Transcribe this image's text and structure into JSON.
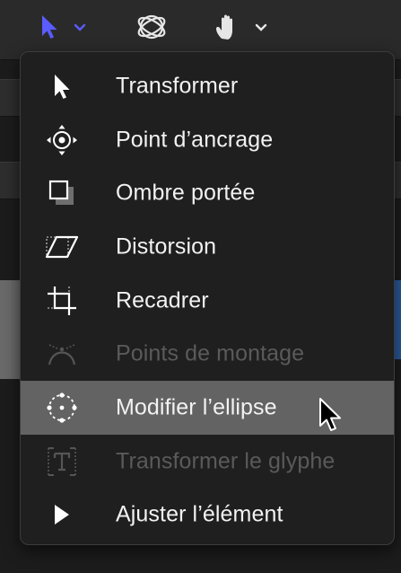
{
  "toolbar": {
    "select_tool_icon": "arrow-pointer-icon",
    "select_tool_dropdown_icon": "chevron-down-icon",
    "orbit_tool_icon": "3d-orbit-icon",
    "pan_tool_icon": "hand-icon",
    "pan_tool_dropdown_icon": "chevron-down-icon",
    "accent_color": "#5a5cff"
  },
  "menu": {
    "highlight_color": "#636363",
    "items": [
      {
        "label": "Transformer",
        "icon": "arrow-pointer-icon",
        "enabled": true,
        "selected": false
      },
      {
        "label": "Point d’ancrage",
        "icon": "anchor-point-icon",
        "enabled": true,
        "selected": false
      },
      {
        "label": "Ombre portée",
        "icon": "drop-shadow-icon",
        "enabled": true,
        "selected": false
      },
      {
        "label": "Distorsion",
        "icon": "distort-icon",
        "enabled": true,
        "selected": false
      },
      {
        "label": "Recadrer",
        "icon": "crop-icon",
        "enabled": true,
        "selected": false
      },
      {
        "label": "Points de montage",
        "icon": "edit-points-icon",
        "enabled": false,
        "selected": false
      },
      {
        "label": "Modifier l’ellipse",
        "icon": "ellipse-edit-icon",
        "enabled": true,
        "selected": true
      },
      {
        "label": "Transformer le glyphe",
        "icon": "glyph-transform-icon",
        "enabled": false,
        "selected": false
      },
      {
        "label": "Ajuster l’élément",
        "icon": "adjust-item-icon",
        "enabled": true,
        "selected": false
      }
    ]
  }
}
